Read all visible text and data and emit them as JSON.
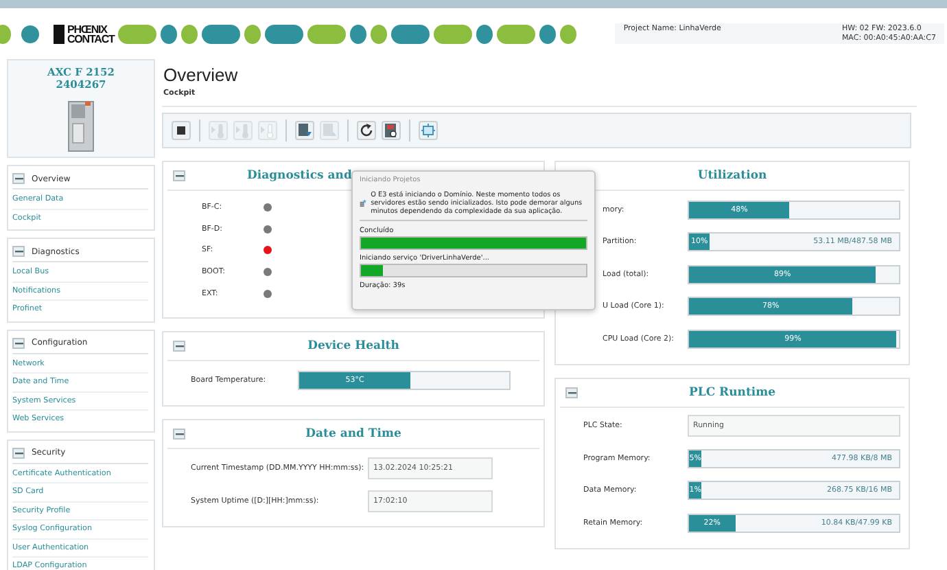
{
  "header": {
    "logo": [
      "PHŒNIX",
      "CONTACT"
    ],
    "project": "Project Name: LinhaVerde",
    "hw": "HW: 02 FW: 2023.6.0",
    "mac": "MAC: 00:A0:45:A0:AA:C7"
  },
  "device": {
    "name": "AXC F 2152",
    "number": "2404267"
  },
  "page": {
    "title": "Overview",
    "subtitle": "Cockpit"
  },
  "toolbar": [
    [
      {
        "kind": "stop",
        "disabled": false
      }
    ],
    [
      {
        "kind": "run-cold",
        "disabled": true
      },
      {
        "kind": "run-warm",
        "disabled": true
      },
      {
        "kind": "run-hot",
        "disabled": true
      }
    ],
    [
      {
        "kind": "download",
        "disabled": false
      },
      {
        "kind": "upload",
        "disabled": true
      }
    ],
    [
      {
        "kind": "reset",
        "disabled": false
      },
      {
        "kind": "reset-device",
        "disabled": false
      }
    ],
    [
      {
        "kind": "network",
        "disabled": false
      }
    ]
  ],
  "sidebar": [
    {
      "title": "Overview",
      "expanded": true,
      "items": [
        "General Data",
        "Cockpit"
      ]
    },
    {
      "title": "Diagnostics",
      "expanded": true,
      "items": [
        "Local Bus",
        "Notifications",
        "Profinet"
      ]
    },
    {
      "title": "Configuration",
      "expanded": true,
      "items": [
        "Network",
        "Date and Time",
        "System Services",
        "Web Services"
      ]
    },
    {
      "title": "Security",
      "expanded": true,
      "items": [
        "Certificate Authentication",
        "SD Card",
        "Security Profile",
        "Syslog Configuration",
        "User Authentication",
        "LDAP Configuration"
      ]
    }
  ],
  "diagnostics": {
    "title": "Diagnostics and",
    "leds": [
      {
        "label": "BF-C:",
        "color": "#7a7a7a"
      },
      {
        "label": "BF-D:",
        "color": "#7a7a7a"
      },
      {
        "label": "SF:",
        "color": "#e8141b"
      },
      {
        "label": "BOOT:",
        "color": "#7a7a7a"
      },
      {
        "label": "EXT:",
        "color": "#7a7a7a"
      }
    ]
  },
  "device_health": {
    "title": "Device Health",
    "label": "Board Temperature:",
    "level": 0.53,
    "reading": "53°C"
  },
  "date_time": {
    "title": "Date and Time",
    "fields": [
      {
        "label": "Current Timestamp (DD.MM.YYYY HH:mm:ss):",
        "value": "13.02.2024  10:25:21"
      },
      {
        "label": "System Uptime ([D:][HH:]mm:ss):",
        "value": "17:02:10"
      }
    ]
  },
  "utilization": {
    "title": "Utilization",
    "bars": [
      {
        "label": "mory:",
        "level": 0.48,
        "reading": "48%"
      },
      {
        "label": "Partition:",
        "level": 0.1,
        "reading": "10%",
        "detail": "53.11 MB/487.58 MB"
      },
      {
        "label": "Load (total):",
        "level": 0.89,
        "reading": "89%"
      },
      {
        "label": "U Load (Core 1):",
        "level": 0.78,
        "reading": "78%"
      },
      {
        "label": "CPU Load (Core 2):",
        "level": 0.99,
        "reading": "99%"
      }
    ]
  },
  "plc_runtime": {
    "title": "PLC Runtime",
    "state_label": "PLC State:",
    "state": "Running",
    "bars": [
      {
        "label": "Program Memory:",
        "level": 0.06,
        "reading": "5%",
        "detail": "477.98 KB/8 MB"
      },
      {
        "label": "Data Memory:",
        "level": 0.06,
        "reading": "1%",
        "detail": "268.75 KB/16 MB"
      },
      {
        "label": "Retain Memory:",
        "level": 0.22,
        "reading": "22%",
        "detail": "10.84 KB/47.99 KB"
      }
    ]
  },
  "dialog": {
    "title": "Iniciando Projetos",
    "message": "O E3 está iniciando o Domínio. Neste momento todos os servidores estão sendo inicializados. Isto pode demorar alguns minutos dependendo da complexidade da sua aplicação.",
    "progress": [
      {
        "label": "Concluído",
        "level": 1
      },
      {
        "label": "Iniciando serviço 'DriverLinhaVerde'...",
        "level": 0.1
      }
    ],
    "duration": "Duração: 39s"
  }
}
